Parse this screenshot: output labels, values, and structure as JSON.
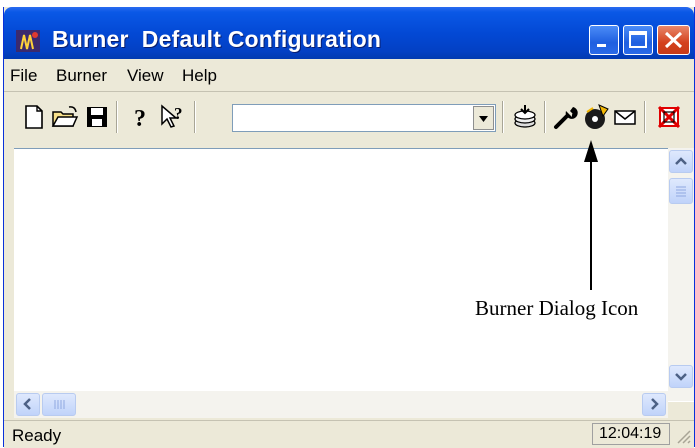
{
  "window": {
    "title": "Burner  Default Configuration"
  },
  "menu": {
    "items": [
      "File",
      "Burner",
      "View",
      "Help"
    ]
  },
  "toolbar": {
    "combo_value": ""
  },
  "status": {
    "text": "Ready",
    "clock": "12:04:19"
  },
  "annotation": {
    "label": "Burner Dialog Icon"
  },
  "colors": {
    "titlebar": "#0349d5",
    "close_button": "#d4411d",
    "chrome": "#ece9d8"
  }
}
